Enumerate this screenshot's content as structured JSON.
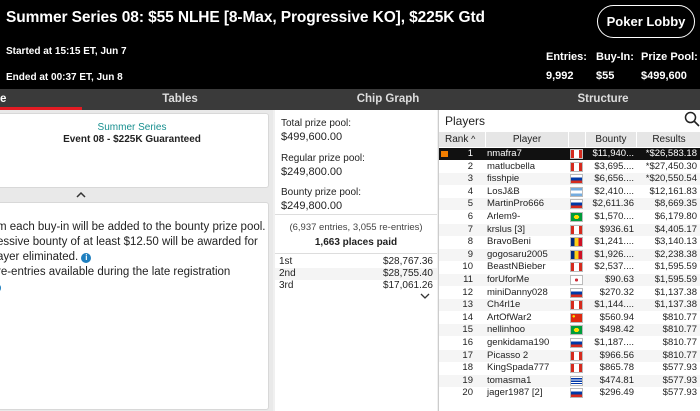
{
  "header": {
    "title": "Summer Series 08: $55 NLHE [8-Max, Progressive KO], $225K Gtd",
    "lobby_button": "Poker Lobby",
    "started": "Started at 15:15 ET, Jun 7",
    "ended": "Ended at 00:37 ET, Jun 8",
    "stats": {
      "entries_label": "Entries:",
      "entries_value": "9,992",
      "buyin_label": "Buy-In:",
      "buyin_value": "$55",
      "prize_label": "Prize Pool:",
      "prize_value": "$499,600"
    }
  },
  "tabs": [
    {
      "label": "e"
    },
    {
      "label": "Tables"
    },
    {
      "label": "Chip Graph"
    },
    {
      "label": "Structure"
    }
  ],
  "tournament_info": {
    "series": "Summer Series",
    "event": "Event 08 - $225K Guaranteed",
    "rules": [
      "m each buy-in will be added to the bounty prize pool.",
      "essive bounty of at least $12.50 will be awarded for",
      "ayer eliminated.",
      "re-entries available during the late registration",
      ""
    ],
    "info_symbol": "i"
  },
  "prizes": {
    "total_label": "Total prize pool:",
    "total_value": "$499,600.00",
    "regular_label": "Regular prize pool:",
    "regular_value": "$249,800.00",
    "bounty_label": "Bounty prize pool:",
    "bounty_value": "$249,800.00",
    "entries_line": "(6,937 entries, 3,055 re-entries)",
    "places_paid": "1,663 places paid",
    "payouts": [
      {
        "place": "1st",
        "amount": "$28,767.36"
      },
      {
        "place": "2nd",
        "amount": "$28,755.40"
      },
      {
        "place": "3rd",
        "amount": "$17,061.26"
      }
    ]
  },
  "players": {
    "title": "Players",
    "columns": {
      "rank": "Rank",
      "player": "Player",
      "bounty": "Bounty",
      "results": "Results"
    },
    "rows": [
      {
        "rank": "1",
        "name": "nmafra7",
        "bounty": "$11,940...",
        "result": "*$26,583.18",
        "flag": "ca"
      },
      {
        "rank": "2",
        "name": "matlucbella",
        "bounty": "$3,695....",
        "result": "*$27,450.30",
        "flag": "ca"
      },
      {
        "rank": "3",
        "name": "fisshpie",
        "bounty": "$6,656....",
        "result": "*$20,550.54",
        "flag": "ru"
      },
      {
        "rank": "4",
        "name": "LosJ&B",
        "bounty": "$2,410....",
        "result": "$12,161.83",
        "flag": "ar"
      },
      {
        "rank": "5",
        "name": "MartinPro666",
        "bounty": "$2,611.36",
        "result": "$8,669.35",
        "flag": "ru"
      },
      {
        "rank": "6",
        "name": "Arlem9-",
        "bounty": "$1,570....",
        "result": "$6,179.80",
        "flag": "br"
      },
      {
        "rank": "7",
        "name": "krslus [3]",
        "bounty": "$936.61",
        "result": "$4,405.17",
        "flag": "ca"
      },
      {
        "rank": "8",
        "name": "BravoBeni",
        "bounty": "$1,241....",
        "result": "$3,140.13",
        "flag": "ro"
      },
      {
        "rank": "9",
        "name": "gogosaru2005",
        "bounty": "$1,926....",
        "result": "$2,238.38",
        "flag": "ro"
      },
      {
        "rank": "10",
        "name": "BeastNBieber",
        "bounty": "$2,537....",
        "result": "$1,595.59",
        "flag": "ca"
      },
      {
        "rank": "11",
        "name": "forUforMe",
        "bounty": "$90.63",
        "result": "$1,595.59",
        "flag": "kr"
      },
      {
        "rank": "12",
        "name": "miniDanny028",
        "bounty": "$270.32",
        "result": "$1,137.38",
        "flag": "ru"
      },
      {
        "rank": "13",
        "name": "Ch4rl1e",
        "bounty": "$1,144....",
        "result": "$1,137.38",
        "flag": "ca"
      },
      {
        "rank": "14",
        "name": "ArtOfWar2",
        "bounty": "$560.94",
        "result": "$810.77",
        "flag": "cn"
      },
      {
        "rank": "15",
        "name": "nellinhoo",
        "bounty": "$498.42",
        "result": "$810.77",
        "flag": "br"
      },
      {
        "rank": "16",
        "name": "genkidama190",
        "bounty": "$1,187....",
        "result": "$810.77",
        "flag": "ru"
      },
      {
        "rank": "17",
        "name": "Picasso 2",
        "bounty": "$966.56",
        "result": "$810.77",
        "flag": "ca"
      },
      {
        "rank": "18",
        "name": "KingSpada777",
        "bounty": "$865.78",
        "result": "$577.93",
        "flag": "ca"
      },
      {
        "rank": "19",
        "name": "tomasma1",
        "bounty": "$474.81",
        "result": "$577.93",
        "flag": "uy"
      },
      {
        "rank": "20",
        "name": "jager1987 [2]",
        "bounty": "$296.49",
        "result": "$577.93",
        "flag": "ru"
      }
    ]
  },
  "colors": {
    "accent_red": "#e31b23",
    "teal": "#178f8f",
    "info_blue": "#1f7fbf",
    "highlight_orange": "#f07d00"
  }
}
